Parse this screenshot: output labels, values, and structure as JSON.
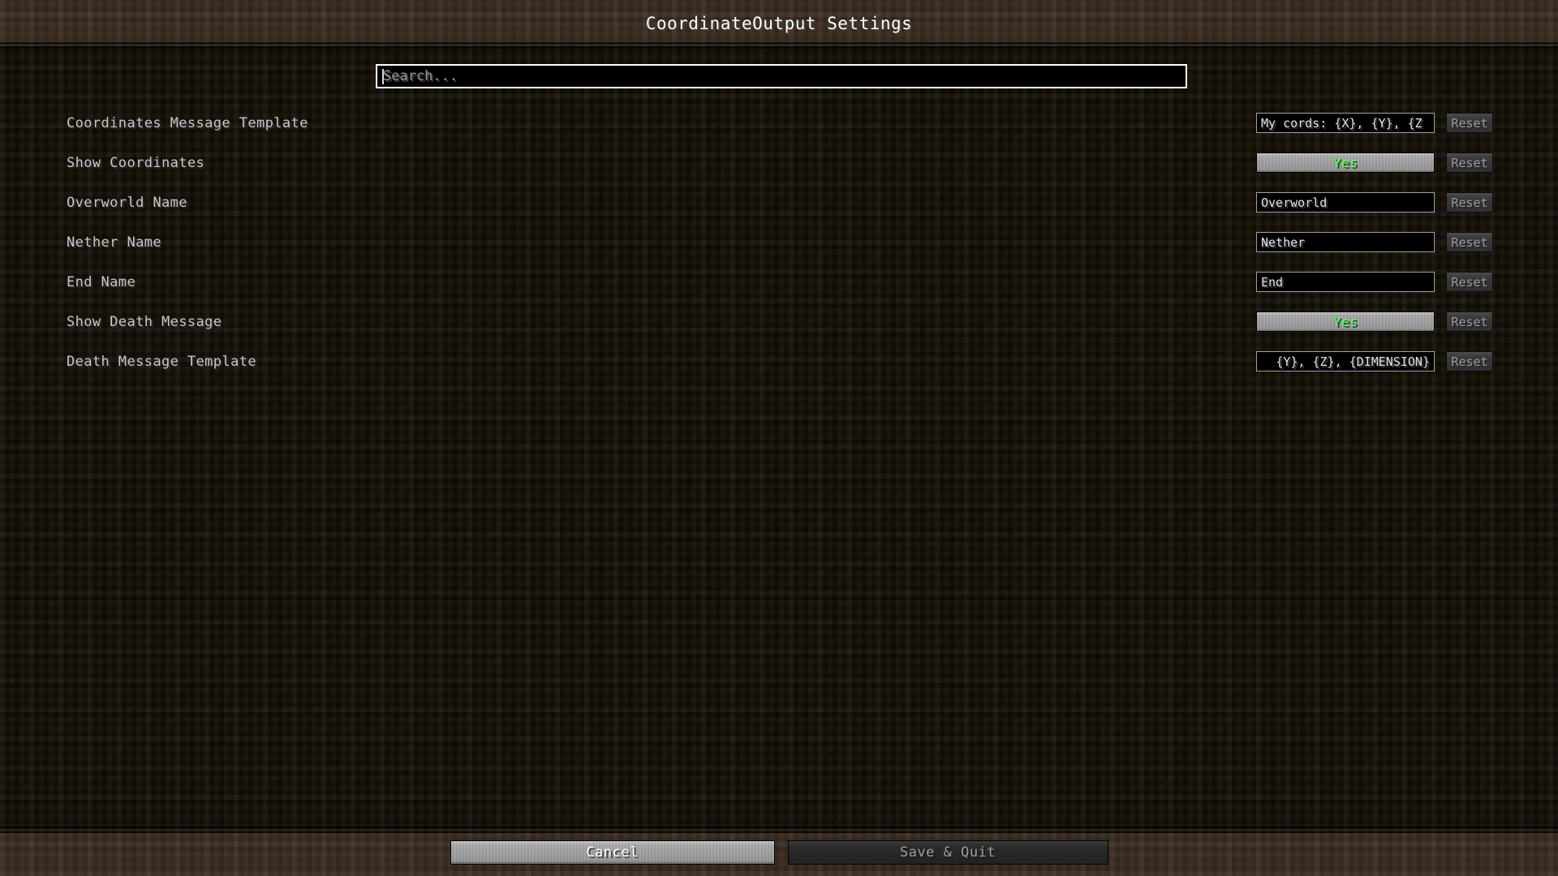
{
  "header": {
    "title": "CoordinateOutput Settings"
  },
  "search": {
    "value": "",
    "placeholder": "Search..."
  },
  "options": [
    {
      "label": "Coordinates Message Template",
      "type": "text",
      "value": "My cords: {X}, {Y}, {Z",
      "align": "clip-right",
      "reset_label": "Reset"
    },
    {
      "label": "Show Coordinates",
      "type": "toggle",
      "value": "Yes",
      "value_color": "#55ff55",
      "reset_label": "Reset"
    },
    {
      "label": "Overworld Name",
      "type": "text",
      "value": "Overworld",
      "align": "clip-right",
      "reset_label": "Reset"
    },
    {
      "label": "Nether Name",
      "type": "text",
      "value": "Nether",
      "align": "clip-right",
      "reset_label": "Reset"
    },
    {
      "label": "End Name",
      "type": "text",
      "value": "End",
      "align": "clip-right",
      "reset_label": "Reset"
    },
    {
      "label": "Show Death Message",
      "type": "toggle",
      "value": "Yes",
      "value_color": "#55ff55",
      "reset_label": "Reset"
    },
    {
      "label": "Death Message Template",
      "type": "text",
      "value": "{Y}, {Z}, {DIMENSION}",
      "align": "clip-left",
      "reset_label": "Reset"
    }
  ],
  "footer": {
    "cancel_label": "Cancel",
    "save_label": "Save & Quit"
  },
  "colors": {
    "accent_green": "#55ff55",
    "label_gray": "#c8c8c8",
    "dirt_header": "#3a2c20",
    "dirt_body": "#161108",
    "button_hover": "#a8a8a8",
    "button_idle": "#2b2b2b"
  }
}
